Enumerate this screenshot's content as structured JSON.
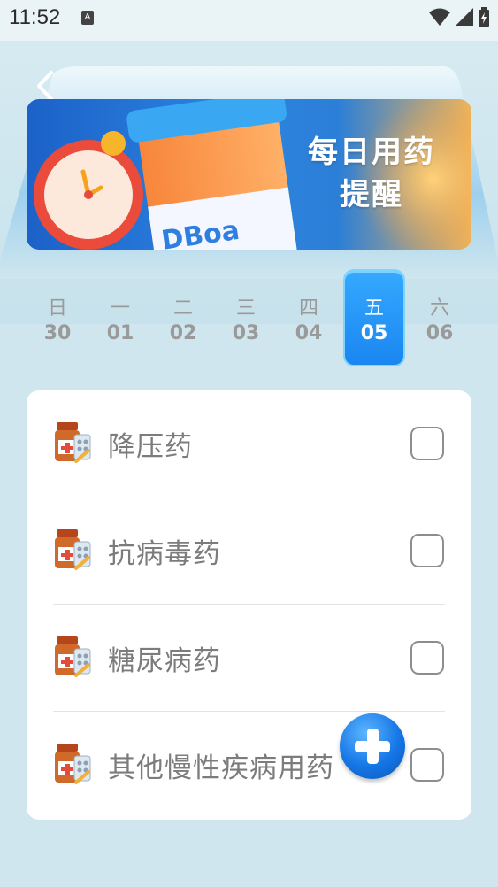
{
  "status_bar": {
    "time": "11:52",
    "app_icon": "A",
    "icons": [
      "wifi-icon",
      "signal-icon",
      "battery-icon"
    ]
  },
  "banner": {
    "title_line1": "每日用药",
    "title_line2": "提醒",
    "image_text": "DBoa"
  },
  "week": [
    {
      "dow": "日",
      "num": "30",
      "active": false
    },
    {
      "dow": "一",
      "num": "01",
      "active": false
    },
    {
      "dow": "二",
      "num": "02",
      "active": false
    },
    {
      "dow": "三",
      "num": "03",
      "active": false
    },
    {
      "dow": "四",
      "num": "04",
      "active": false
    },
    {
      "dow": "五",
      "num": "05",
      "active": true
    },
    {
      "dow": "六",
      "num": "06",
      "active": false
    }
  ],
  "medications": [
    {
      "label": "降压药",
      "checked": false,
      "icon": "medicine-bottle-icon"
    },
    {
      "label": "抗病毒药",
      "checked": false,
      "icon": "medicine-bottle-icon"
    },
    {
      "label": "糖尿病药",
      "checked": false,
      "icon": "medicine-bottle-icon"
    },
    {
      "label": "其他慢性疾病用药",
      "checked": false,
      "icon": "medicine-bottle-icon"
    }
  ],
  "colors": {
    "accent": "#1a86f0",
    "background": "#cfe6ee",
    "banner_blue": "#1c61c8"
  }
}
